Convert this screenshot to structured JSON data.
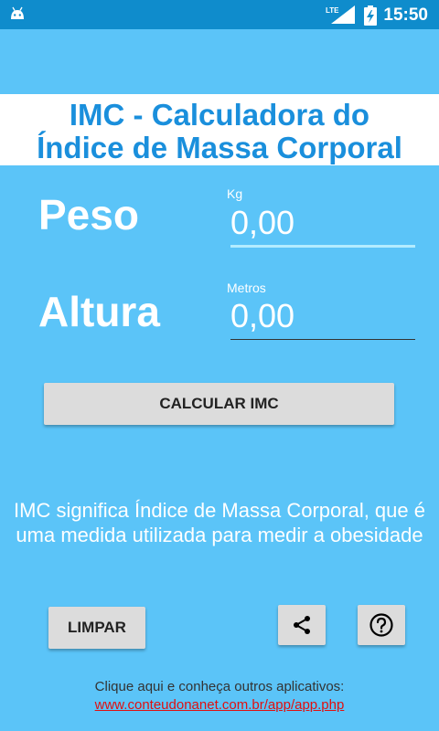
{
  "status_bar": {
    "time": "15:50",
    "network": "LTE"
  },
  "title": {
    "line1": "IMC - Calculadora do",
    "line2": "Índice de Massa Corporal"
  },
  "peso": {
    "label": "Peso",
    "unit_hint": "Kg",
    "value": "0,00"
  },
  "altura": {
    "label": "Altura",
    "unit_hint": "Metros",
    "value": "0,00"
  },
  "calculate_button": {
    "label": "CALCULAR IMC"
  },
  "description": "IMC significa Índice de Massa Corporal, que é uma medida utilizada para medir a obesidade",
  "clear_button": {
    "label": "LIMPAR"
  },
  "footer": {
    "text": "Clique aqui e conheça outros aplicativos:",
    "link": "www.conteudonanet.com.br/app/app.php"
  },
  "colors": {
    "background": "#5bc4f8",
    "status_bar": "#0f8ccc",
    "title_text": "#1a8fdc",
    "active_underline": "#b3ecff",
    "link": "#e01010"
  },
  "icons": [
    "android-icon",
    "lte-signal-icon",
    "battery-charging-icon",
    "share-icon",
    "help-icon"
  ]
}
